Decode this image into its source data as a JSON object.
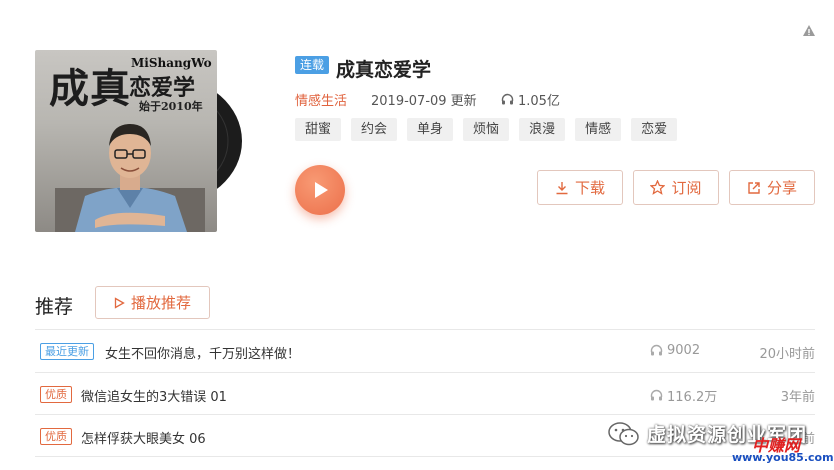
{
  "cover": {
    "title": "成真",
    "brand": "MiShangWo",
    "subtitle": "恋爱学",
    "since": "始于2010年"
  },
  "album": {
    "serial_badge": "连载",
    "title": "成真恋爱学",
    "category": "情感生活",
    "updated": "2019-07-09 更新",
    "plays": "1.05亿",
    "tags": [
      "甜蜜",
      "约会",
      "单身",
      "烦恼",
      "浪漫",
      "情感",
      "恋爱"
    ]
  },
  "actions": {
    "download": "下载",
    "subscribe": "订阅",
    "share": "分享"
  },
  "recommend": {
    "title": "推荐",
    "play_button": "播放推荐",
    "items": [
      {
        "badge": "最近更新",
        "badge_type": "new",
        "title": "女生不回你消息，千万别这样做！",
        "plays": "9002",
        "time": "20小时前"
      },
      {
        "badge": "优质",
        "badge_type": "quality",
        "title": "微信追女生的3大错误 01",
        "plays": "116.2万",
        "time": "3年前"
      },
      {
        "badge": "优质",
        "badge_type": "quality",
        "title": "怎样俘获大眼美女 06",
        "plays": "",
        "time": "前"
      }
    ]
  },
  "watermark": {
    "text": "虚拟资源创业军团",
    "logo": "中赚网",
    "url": "www.you85.com"
  },
  "colors": {
    "accent": "#e2693f",
    "blue": "#4b9fe4"
  }
}
